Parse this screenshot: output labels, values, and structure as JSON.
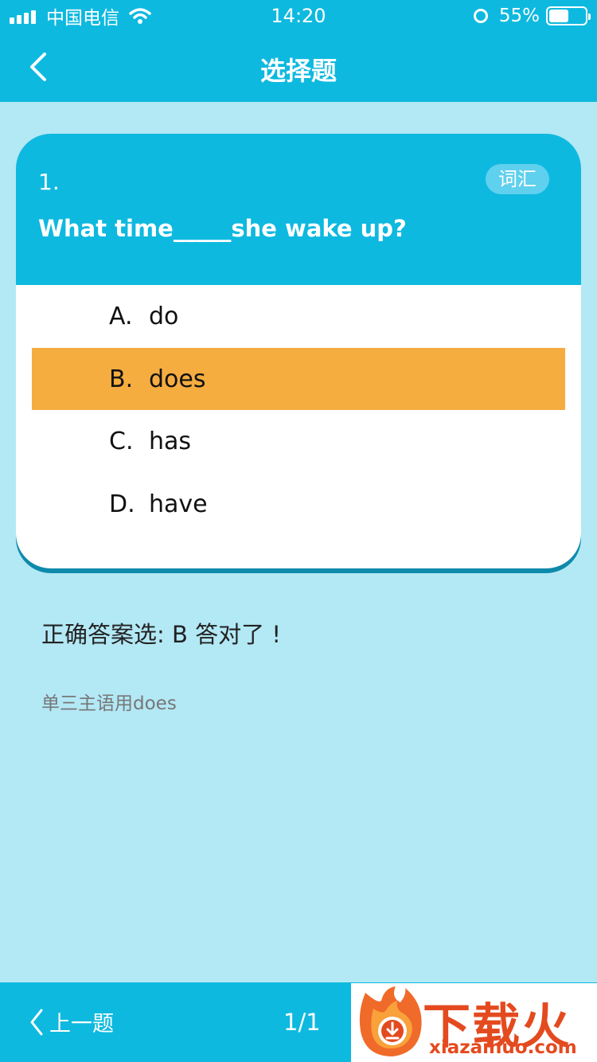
{
  "status_bar": {
    "carrier": "中国电信",
    "time": "14:20",
    "battery_percent_label": "55%",
    "battery_level": 0.55
  },
  "nav": {
    "title": "选择题",
    "back_icon": "chevron-left-icon"
  },
  "question": {
    "number": "1.",
    "tag": "词汇",
    "text": "What time_____she wake up?",
    "options": [
      {
        "letter": "A.",
        "text": "do",
        "selected": false
      },
      {
        "letter": "B.",
        "text": "does",
        "selected": true
      },
      {
        "letter": "C.",
        "text": "has",
        "selected": false
      },
      {
        "letter": "D.",
        "text": "have",
        "selected": false
      }
    ]
  },
  "result": {
    "answer_line": "正确答案选: B 答对了 !",
    "explanation": "单三主语用does"
  },
  "bottom": {
    "prev_label": "上一题",
    "page": "1/1"
  },
  "watermark": {
    "title": "下载火",
    "url": "xiazaihuo.com"
  },
  "colors": {
    "primary": "#0eb9df",
    "background": "#b3e8f5",
    "selected_option": "#f5ad40",
    "card_shadow": "#0e8aab",
    "tag_bg": "#5fd0ee"
  }
}
